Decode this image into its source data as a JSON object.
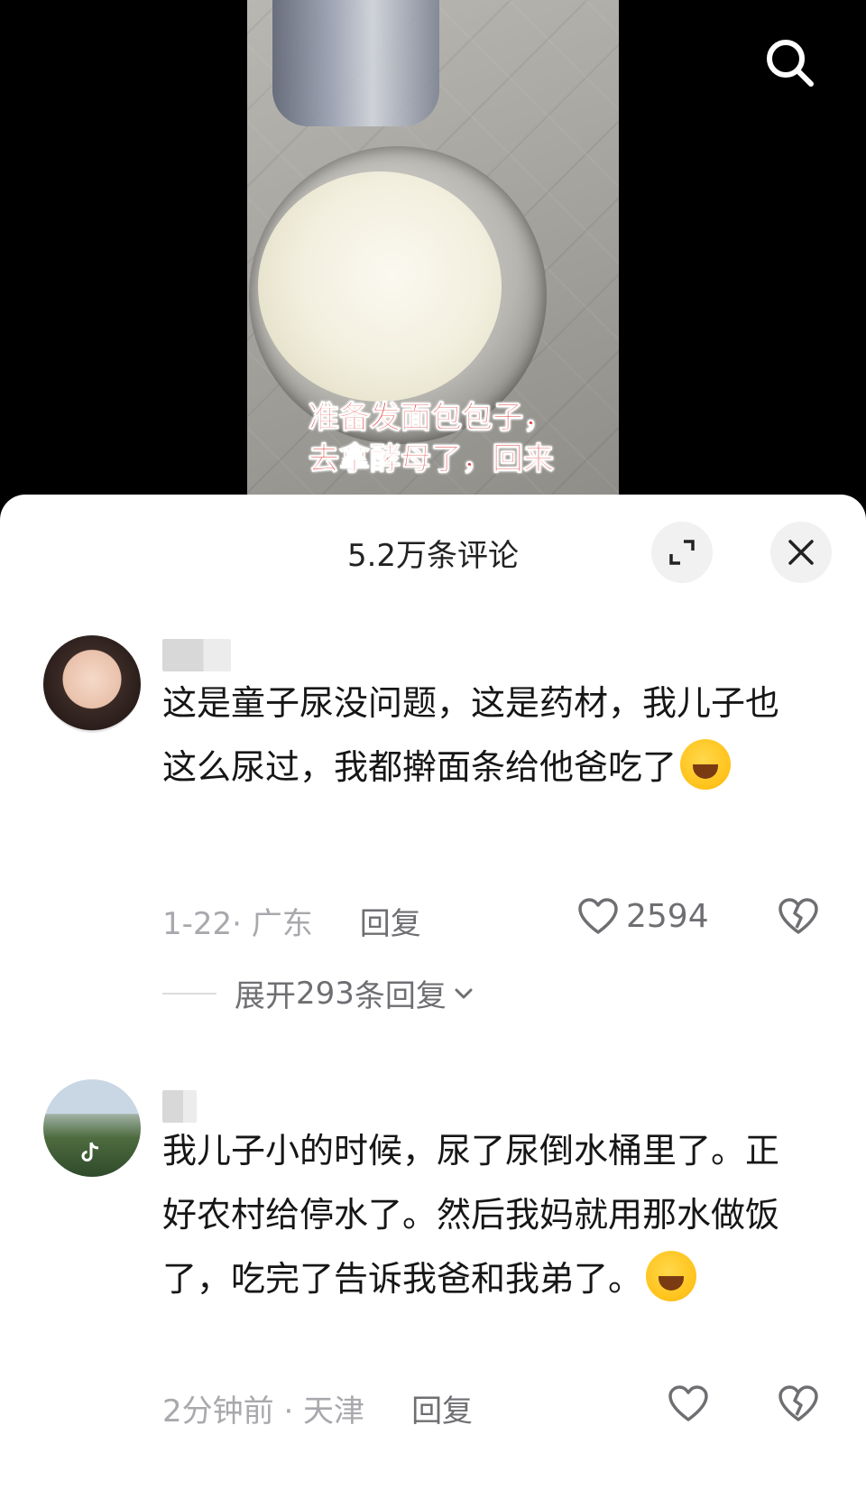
{
  "video": {
    "caption_lines": [
      "准备发面包包子，",
      "去拿酵母了，回来"
    ],
    "search_icon": "search-icon"
  },
  "sheet": {
    "title": "5.2万条评论",
    "expand_icon": "expand-icon",
    "close_icon": "close-icon"
  },
  "comments": [
    {
      "text": "这是童子尿没问题，这是药材，我儿子也这么尿过，我都擀面条给他爸吃了",
      "emoji": "laughing-crying-emoji",
      "time_location": "1-22· 广东",
      "reply_label": "回复",
      "likes": "2594",
      "expand_prefix": "展开 ",
      "expand_count": "293",
      "expand_suffix": " 条回复"
    },
    {
      "text": "我儿子小的时候，尿了尿倒水桶里了。正好农村给停水了。然后我妈就用那水做饭了，吃完了告诉我爸和我弟了。",
      "emoji": "grinning-sweat-emoji",
      "time_location": "2分钟前 · 天津",
      "reply_label": "回复"
    }
  ],
  "colors": {
    "caption_red": "#e23636",
    "meta_gray": "#a8a8ad",
    "text_dark": "#161616"
  }
}
